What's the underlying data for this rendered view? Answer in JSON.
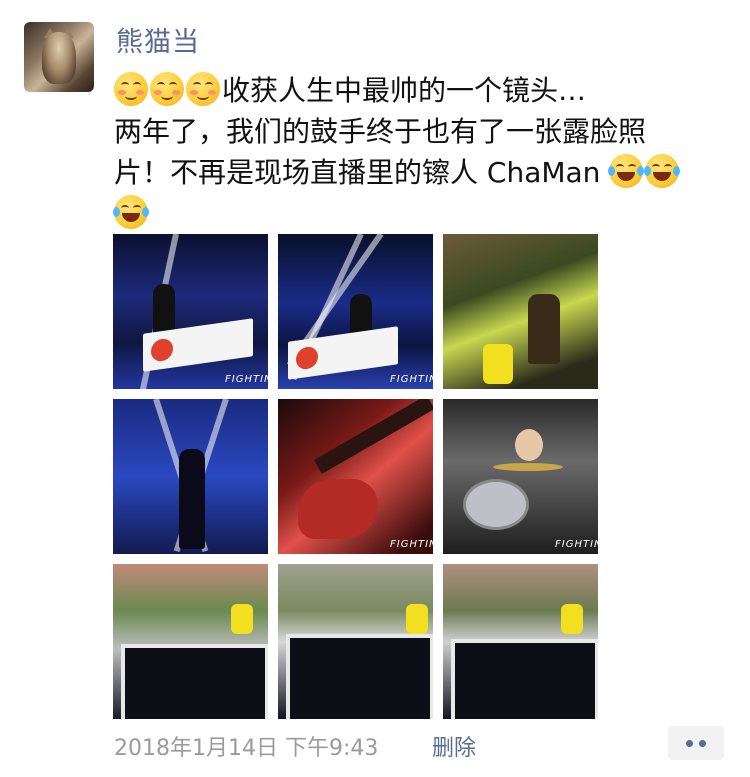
{
  "post": {
    "username": "熊猫当",
    "text_line1": "收获人生中最帅的一个镜头…",
    "text_line2": "两年了，我们的鼓手终于也有了一张露脸照",
    "text_line3": "片！不再是现场直播里的镲人 ChaMan",
    "emoji_names": [
      "blush-smile-icon",
      "blush-smile-icon",
      "blush-smile-icon",
      "tears-of-joy-icon",
      "tears-of-joy-icon",
      "tears-of-joy-icon"
    ],
    "photos": [
      {
        "name": "photo-stage-1",
        "caption": "FIGHTIN"
      },
      {
        "name": "photo-stage-2",
        "caption": "FIGHTIN"
      },
      {
        "name": "photo-guitarist-yellow-light",
        "caption": ""
      },
      {
        "name": "photo-singer-on-stage",
        "caption": ""
      },
      {
        "name": "photo-bass-guitar",
        "caption": "FIGHTIN"
      },
      {
        "name": "photo-drummer",
        "caption": "FIGHTIN"
      },
      {
        "name": "photo-tv-screen-1",
        "caption": ""
      },
      {
        "name": "photo-tv-screen-2",
        "caption": ""
      },
      {
        "name": "photo-tv-screen-3",
        "caption": ""
      }
    ]
  },
  "footer": {
    "timestamp": "2018年1月14日 下午9:43",
    "delete_label": "删除",
    "more_icon": "more-dots-icon"
  },
  "colors": {
    "username": "#576b95",
    "link": "#576b95",
    "timestamp": "#9b9b9b",
    "text": "#111111"
  }
}
